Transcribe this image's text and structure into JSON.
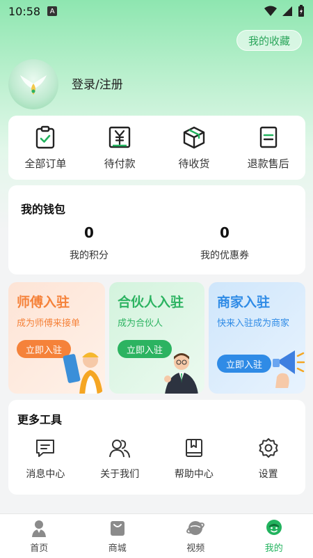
{
  "status": {
    "time": "10:58",
    "notif_letter": "A"
  },
  "header": {
    "favorites_label": "我的收藏",
    "login_label": "登录/注册"
  },
  "orders": [
    {
      "label": "全部订单",
      "icon": "clipboard-check-icon"
    },
    {
      "label": "待付款",
      "icon": "yen-box-icon"
    },
    {
      "label": "待收货",
      "icon": "package-box-icon"
    },
    {
      "label": "退款售后",
      "icon": "refund-doc-icon"
    }
  ],
  "wallet": {
    "title": "我的钱包",
    "points_value": "0",
    "points_label": "我的积分",
    "coupons_value": "0",
    "coupons_label": "我的优惠券"
  },
  "join": [
    {
      "title": "师傅入驻",
      "subtitle": "成为师傅来接单",
      "button": "立即入驻",
      "accent": "#f5823a"
    },
    {
      "title": "合伙人入驻",
      "subtitle": "成为合伙人",
      "button": "立即入驻",
      "accent": "#2cb361"
    },
    {
      "title": "商家入驻",
      "subtitle": "快来入驻成为商家",
      "button": "立即入驻",
      "accent": "#2f8be6"
    }
  ],
  "tools": {
    "title": "更多工具",
    "items": [
      {
        "label": "消息中心",
        "icon": "message-icon"
      },
      {
        "label": "关于我们",
        "icon": "users-icon"
      },
      {
        "label": "帮助中心",
        "icon": "book-icon"
      },
      {
        "label": "设置",
        "icon": "gear-icon"
      }
    ]
  },
  "tabbar": [
    {
      "label": "首页",
      "icon": "home-person-icon",
      "active": false
    },
    {
      "label": "商城",
      "icon": "shopping-bag-icon",
      "active": false
    },
    {
      "label": "视频",
      "icon": "planet-icon",
      "active": false
    },
    {
      "label": "我的",
      "icon": "profile-face-icon",
      "active": true
    }
  ],
  "colors": {
    "brand_green": "#22b35e",
    "master_orange": "#f5823a",
    "merchant_blue": "#2f8be6"
  }
}
